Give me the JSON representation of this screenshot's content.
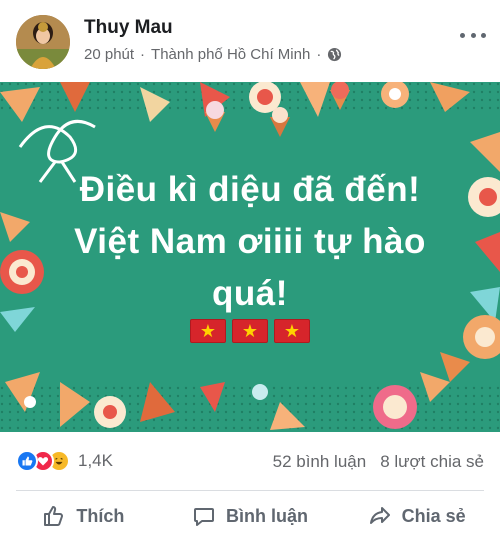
{
  "post": {
    "author": "Thuy Mau",
    "time": "20 phút",
    "location": "Thành phố Hồ Chí Minh",
    "separator": "·",
    "privacy_icon": "globe-icon",
    "more_icon": "more-options-icon"
  },
  "banner": {
    "background_color": "#2b9b7c",
    "lines": [
      "Điều kì diệu đã đến!",
      "Việt Nam ơiiii tự hào",
      "quá!"
    ],
    "flag_emoji": [
      "★",
      "★",
      "★"
    ]
  },
  "reactions": {
    "icons": [
      "like-icon",
      "love-icon",
      "haha-icon"
    ],
    "count": "1,4K",
    "comments": "52 bình luận",
    "shares": "8 lượt chia sẻ"
  },
  "actions": [
    {
      "label": "Thích",
      "icon": "thumbs-up-icon"
    },
    {
      "label": "Bình luận",
      "icon": "comment-icon"
    },
    {
      "label": "Chia sẻ",
      "icon": "share-icon"
    }
  ]
}
